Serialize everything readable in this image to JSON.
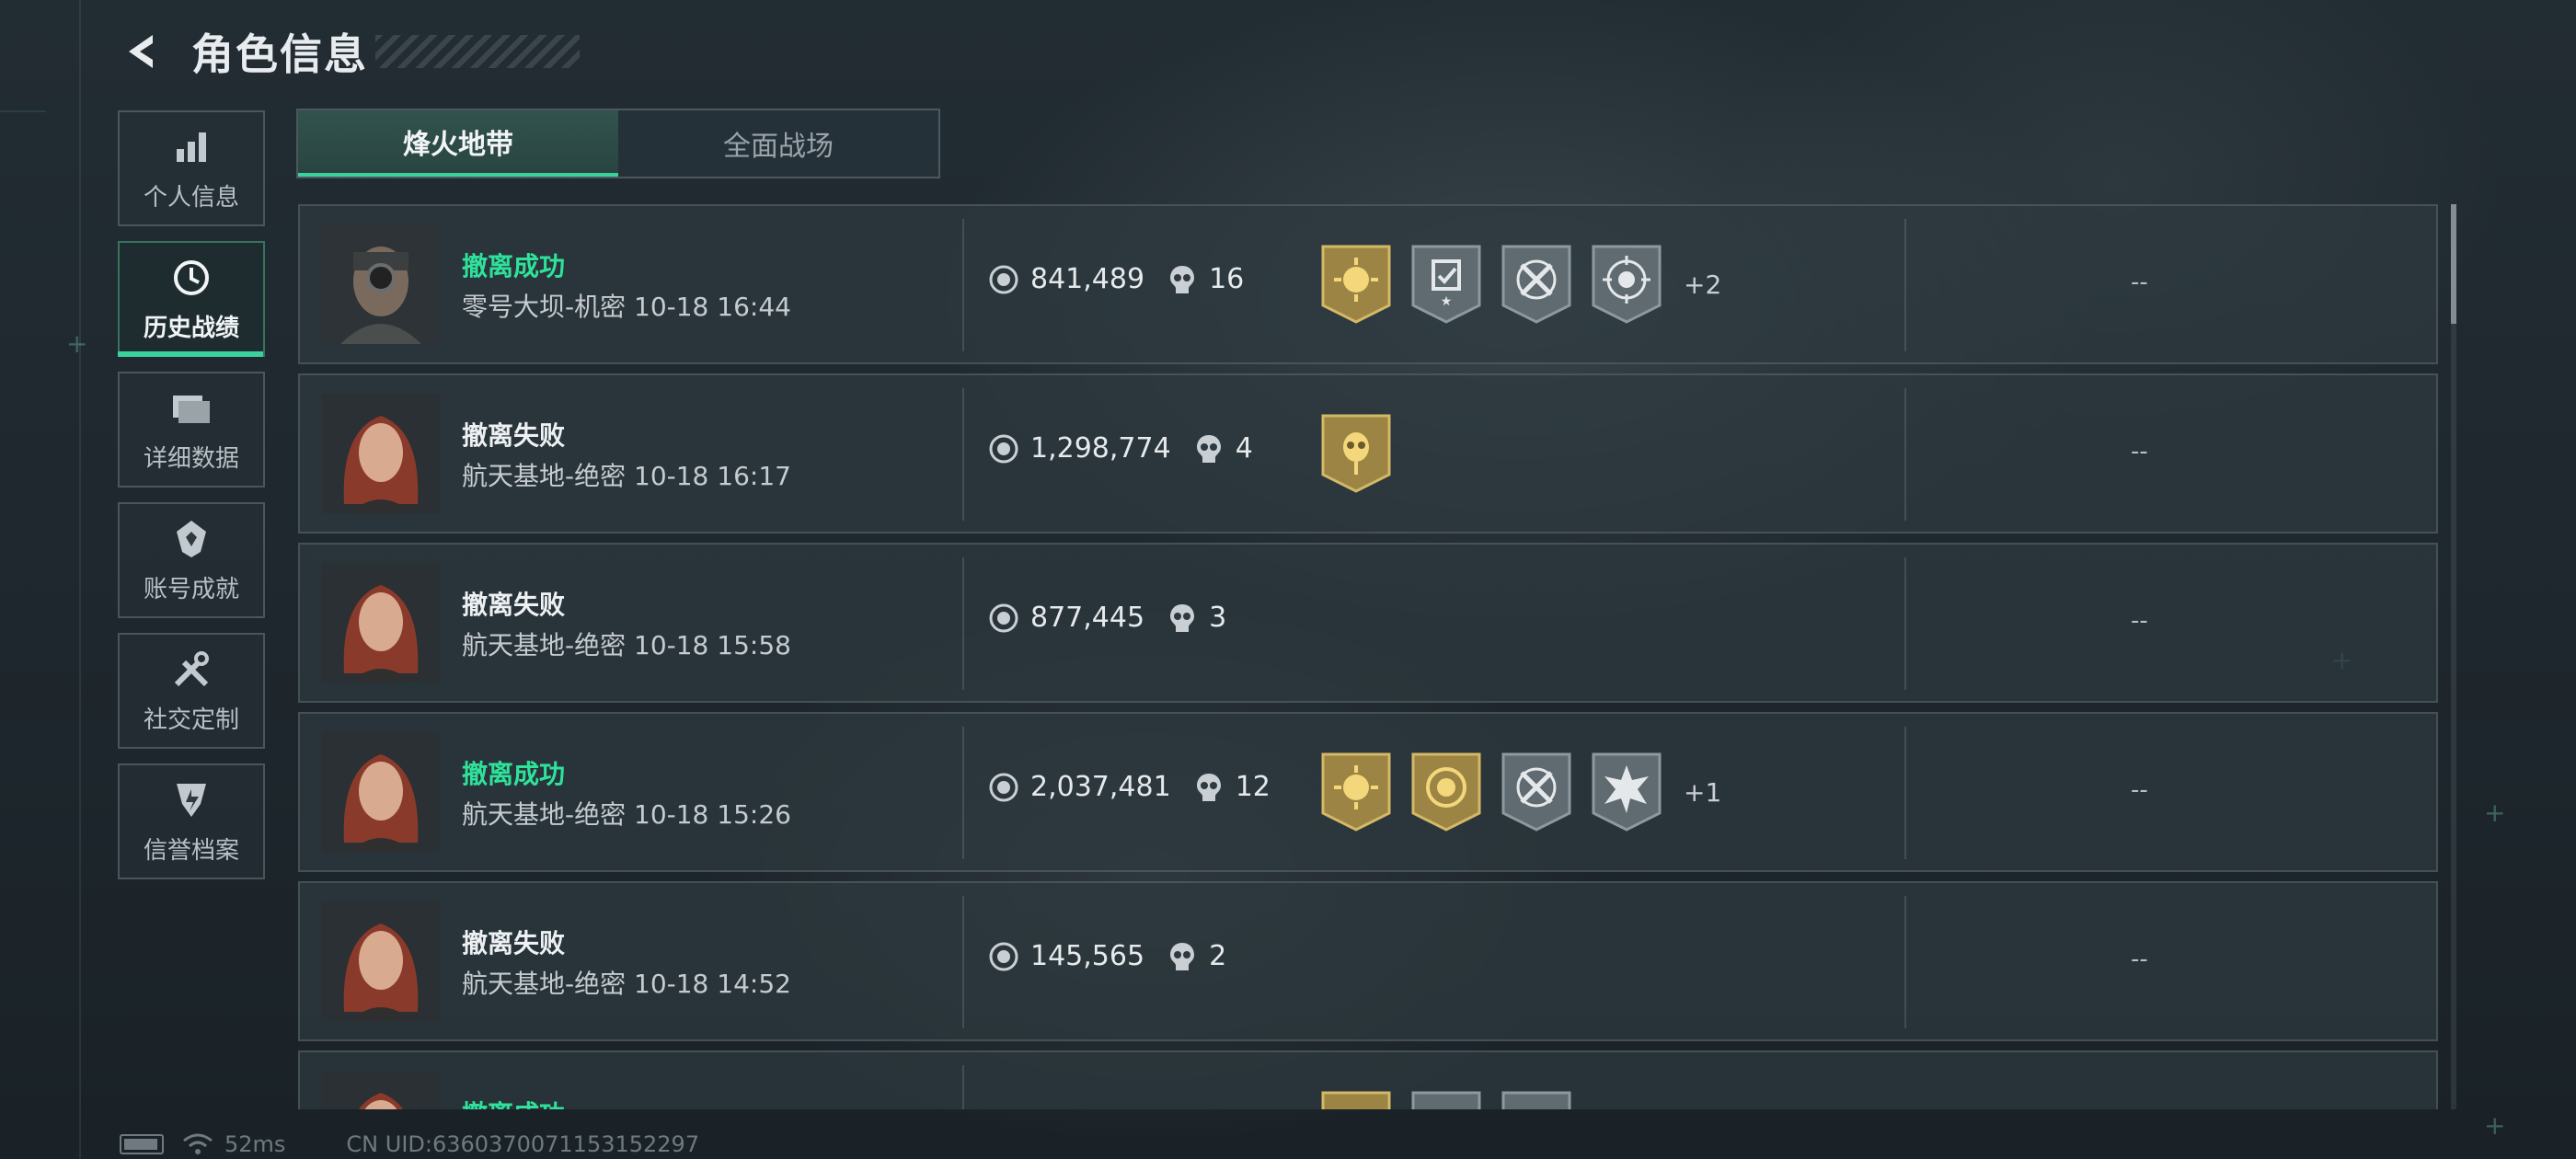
{
  "header": {
    "title": "角色信息",
    "back_icon": "back-arrow-icon"
  },
  "sidebar": {
    "items": [
      {
        "label": "个人信息",
        "icon": "bar-chart-icon"
      },
      {
        "label": "历史战绩",
        "icon": "clock-history-icon",
        "active": true
      },
      {
        "label": "详细数据",
        "icon": "folder-icon"
      },
      {
        "label": "账号成就",
        "icon": "achievement-icon"
      },
      {
        "label": "社交定制",
        "icon": "tools-icon"
      },
      {
        "label": "信誉档案",
        "icon": "shield-badge-icon"
      }
    ]
  },
  "tabs": [
    {
      "label": "烽火地带",
      "active": true
    },
    {
      "label": "全面战场",
      "active": false
    }
  ],
  "records": [
    {
      "result": "撤离成功",
      "success": true,
      "map": "零号大坝-机密 10-18 16:44",
      "value": "841,489",
      "kills": "16",
      "badges": [
        "gold-sun-badge",
        "report-badge",
        "crossed-guns-badge",
        "target-badge"
      ],
      "more": "+2",
      "extra": "--",
      "avatar": "soldier-goggles"
    },
    {
      "result": "撤离失败",
      "success": false,
      "map": "航天基地-绝密 10-18 16:17",
      "value": "1,298,774",
      "kills": "4",
      "badges": [
        "gold-skull-badge"
      ],
      "more": "",
      "extra": "--",
      "avatar": "red-hair-woman"
    },
    {
      "result": "撤离失败",
      "success": false,
      "map": "航天基地-绝密 10-18 15:58",
      "value": "877,445",
      "kills": "3",
      "badges": [],
      "more": "",
      "extra": "--",
      "avatar": "red-hair-woman"
    },
    {
      "result": "撤离成功",
      "success": true,
      "map": "航天基地-绝密 10-18 15:26",
      "value": "2,037,481",
      "kills": "12",
      "badges": [
        "gold-sun-badge",
        "gold-emblem-badge",
        "crossed-guns-badge",
        "burst-badge"
      ],
      "more": "+1",
      "extra": "--",
      "avatar": "red-hair-woman"
    },
    {
      "result": "撤离失败",
      "success": false,
      "map": "航天基地-绝密 10-18 14:52",
      "value": "145,565",
      "kills": "2",
      "badges": [],
      "more": "",
      "extra": "--",
      "avatar": "red-hair-woman"
    },
    {
      "result": "撤离成功",
      "success": true,
      "map": "",
      "value": "",
      "kills": "",
      "badges": [
        "gold-sun-badge",
        "report-badge",
        "crossed-guns-badge"
      ],
      "more": "",
      "extra": "",
      "avatar": "red-hair-woman"
    }
  ],
  "footer": {
    "ping": "52ms",
    "uid": "CN UID:6360370071153152297"
  },
  "colors": {
    "accent": "#3ad29a",
    "success_text": "#2fe29b",
    "gold_badge": "#b8994a",
    "gray_badge": "#6f7b80"
  }
}
